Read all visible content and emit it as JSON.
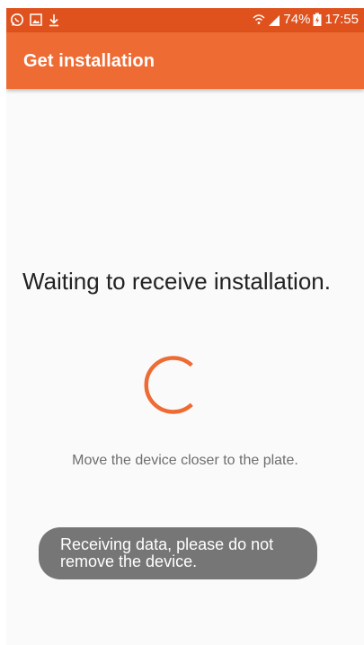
{
  "status_bar": {
    "icons_left": [
      "whatsapp-icon",
      "image-icon",
      "download-icon"
    ],
    "battery_percent": "74%",
    "time": "17:55",
    "icons_right": [
      "wifi-icon",
      "signal-icon",
      "battery-charging-icon"
    ]
  },
  "app_bar": {
    "title": "Get installation"
  },
  "main": {
    "waiting_title": "Waiting to receive installation.",
    "hint": "Move the device closer to the plate."
  },
  "toast": {
    "message": "Receiving data, please do not remove the device."
  },
  "colors": {
    "status_bar": "#e0521d",
    "app_bar": "#ee6b34",
    "spinner": "#ee6b34",
    "toast": "#767676",
    "background": "#fafafa"
  }
}
